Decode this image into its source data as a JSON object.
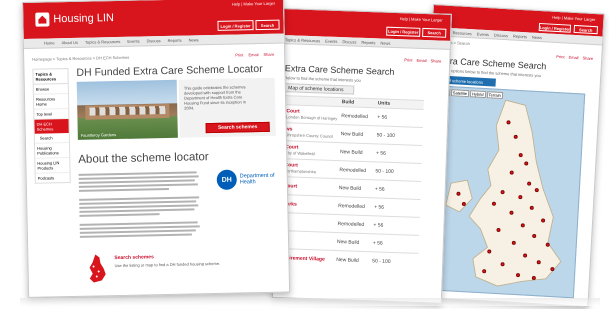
{
  "brand": {
    "name": "Housing LIN",
    "accent": "#d8141c",
    "map_water": "#bcd6ea",
    "map_land": "#f6f1e4"
  },
  "top_links": "Help | Make Your Login",
  "left_page": {
    "top_links": "Help | Make Your Larger",
    "nav_items": [
      "Home",
      "About Us",
      "Topics & Resources",
      "Events",
      "Discuss",
      "Reports",
      "News"
    ],
    "login_button": "Login / Register",
    "search_button": "Search",
    "breadcrumb": "Homepage > Topics & Resources > DH ECH Schemes",
    "tools": [
      "Print",
      "Email",
      "Share"
    ],
    "sidebar_title": "Topics & Resources",
    "sidebar_items": [
      "Browse",
      "Resources Home",
      "Top level",
      "DH ECH Schemes",
      "Search",
      "Housing Publications",
      "Housing LIN Products",
      "Podcasts"
    ],
    "title": "DH Funded Extra Care Scheme Locator",
    "intro_text": "This guide celebrates the schemes developed with support from the Department of Health Extra Care Housing Fund since its inception in 2004.",
    "search_schemes_button": "Search schemes",
    "photo_caption": "Fauntleroy Gardens",
    "about_heading": "About the scheme locator",
    "dh_logo_top": "DH",
    "dh_logo_bottom": "Department of Health",
    "search_link": "Search schemes",
    "search_desc": "Use the listing or map to find a DH funded housing scheme."
  },
  "middle_page": {
    "top_links": "Help | Make Your Larger",
    "nav_items": [
      "Topics & Resources",
      "Events",
      "Discuss",
      "Reports",
      "News"
    ],
    "login_button": "Login / Register",
    "search_button": "Search",
    "tools": [
      "Print",
      "Email",
      "Share"
    ],
    "title": "Extra Care Scheme Search",
    "subtitle": "Below to find the scheme that interests you",
    "tab": "Map of scheme locations",
    "table_headers": [
      "",
      "Build",
      "Units"
    ],
    "rows": [
      {
        "name": "Court",
        "place": "London Borough of Haringey",
        "build": "Remodelled",
        "units": "+ 56"
      },
      {
        "name": "ws",
        "place": "Shropshire County Council",
        "build": "New Build",
        "units": "50 - 100"
      },
      {
        "name": "Court",
        "place": "City of Wakefield",
        "build": "New Build",
        "units": "+ 56"
      },
      {
        "name": "Court",
        "place": "Northamptonshire",
        "build": "Remodelled",
        "units": "50 - 100"
      },
      {
        "name": "Court",
        "place": "",
        "build": "New Build",
        "units": "+ 56"
      },
      {
        "name": "Parks",
        "place": "",
        "build": "Remodelled",
        "units": "+ 56"
      },
      {
        "name": "",
        "place": "",
        "build": "Remodelled",
        "units": "+ 56"
      },
      {
        "name": "",
        "place": "",
        "build": "New Build",
        "units": "+ 56"
      },
      {
        "name": "Retirement Village",
        "place": "",
        "build": "New Build",
        "units": "50 - 100"
      }
    ]
  },
  "right_page": {
    "top_links": "Help | Make Your Larger",
    "nav_items": [
      "Topics & Resources",
      "Events",
      "Discuss",
      "Reports",
      "News"
    ],
    "login_button": "Login / Register",
    "search_button": "Search",
    "tools": [
      "Print",
      "Email",
      "Share"
    ],
    "breadcrumb": "Schemes > Search",
    "title": "Extra Care Scheme Search",
    "subtitle": "Use the options below to find the scheme that interests you",
    "tab": "Map of scheme locations",
    "map_controls": [
      "Map",
      "Satellite",
      "Hybrid",
      "Terrain"
    ]
  }
}
